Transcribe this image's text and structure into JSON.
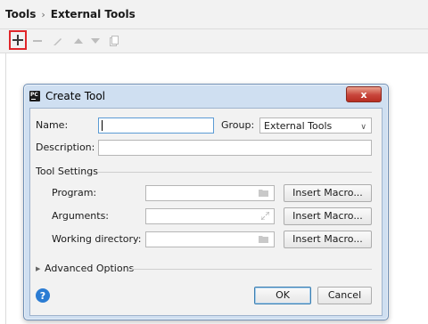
{
  "breadcrumb": {
    "root": "Tools",
    "separator": "›",
    "current": "External Tools"
  },
  "toolbar": {
    "add": "add-icon",
    "remove": "remove-icon",
    "edit": "edit-icon",
    "up": "move-up-icon",
    "down": "move-down-icon",
    "copy": "copy-icon",
    "highlight_color": "#e0262a"
  },
  "dialog": {
    "title": "Create Tool",
    "app_icon_text": "PC",
    "close_label": "x",
    "name_label": "Name:",
    "name_value": "",
    "group_label": "Group:",
    "group_value": "External Tools",
    "description_label": "Description:",
    "description_value": "",
    "tool_settings": "Tool Settings",
    "program_label": "Program:",
    "arguments_label": "Arguments:",
    "workdir_label": "Working directory:",
    "insert_macro": "Insert Macro...",
    "advanced_options": "Advanced Options",
    "ok": "OK",
    "cancel": "Cancel",
    "help": "?"
  }
}
